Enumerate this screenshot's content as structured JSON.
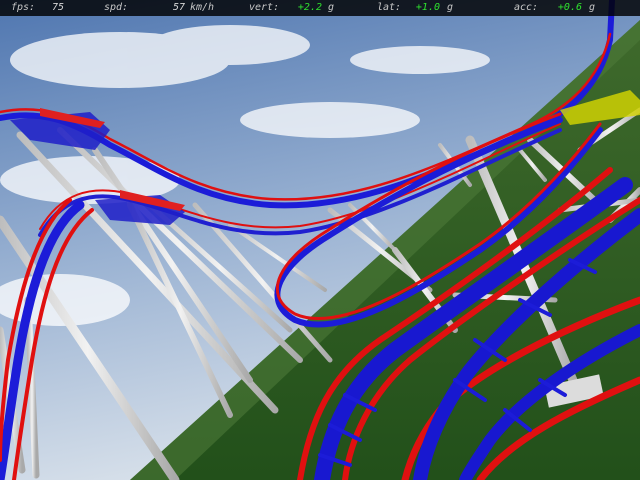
{
  "hud": {
    "fps": {
      "label": "fps:",
      "value": "75"
    },
    "spd": {
      "label": "spd:",
      "value": "57",
      "unit": "km/h"
    },
    "vert": {
      "label": "vert:",
      "value": "+2.2",
      "unit": "g"
    },
    "lat": {
      "label": "lat:",
      "value": "+1.0",
      "unit": "g"
    },
    "acc": {
      "label": "acc:",
      "value": "+0.6",
      "unit": "g"
    }
  },
  "colors": {
    "sky_top": "#5a7fb5",
    "sky_horizon": "#cfd9e6",
    "grass": "#2f5f1e",
    "rail_red": "#e01010",
    "spine_blue": "#1c1cd8",
    "support_white": "#d8d8d8",
    "hud_green": "#2fe02f"
  }
}
